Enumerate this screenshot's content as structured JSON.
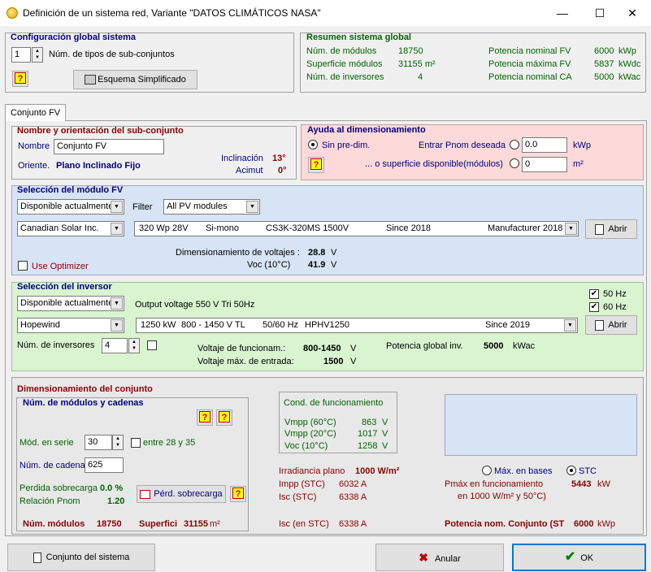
{
  "window": {
    "title": "Definición de un sistema red, Variante   \"DATOS CLIMÁTICOS NASA\"",
    "minimize": "—",
    "maximize": "☐",
    "close": "✕"
  },
  "global_config": {
    "title": "Configuración global sistema",
    "subsets_value": "1",
    "subsets_label": "Núm. de tipos de sub-conjuntos",
    "help": "?",
    "schema_button": "Esquema Simplificado"
  },
  "summary": {
    "title": "Resumen sistema global",
    "modules_label": "Núm. de módulos",
    "modules_value": "18750",
    "surface_label": "Superficie módulos",
    "surface_value": "31155 m²",
    "inverters_label": "Núm. de inversores",
    "inverters_value": "4",
    "pv_nominal_label": "Potencia nominal FV",
    "pv_nominal_value": "6000",
    "pv_nominal_unit": "kWp",
    "pv_max_label": "Potencia máxima FV",
    "pv_max_value": "5837",
    "pv_max_unit": "kWdc",
    "ac_nominal_label": "Potencia nominal CA",
    "ac_nominal_value": "5000",
    "ac_nominal_unit": "kWac"
  },
  "tabs": {
    "tab1": "Conjunto FV"
  },
  "subset": {
    "title": "Nombre y orientación del sub-conjunto",
    "name_label": "Nombre",
    "name_value": "Conjunto FV",
    "orient_label": "Oriente.",
    "orient_value": "Plano Inclinado Fijo",
    "tilt_label": "Inclinación",
    "tilt_value": "13°",
    "azimuth_label": "Acimut",
    "azimuth_value": "0°"
  },
  "sizing_help": {
    "title": "Ayuda al dimensionamiento",
    "no_presize": "Sin pre-dim.",
    "enter_pnom": "Entrar Pnom deseada",
    "pnom_value": "0.0",
    "pnom_unit": "kWp",
    "surface_text": "... o superficie disponible(módulos)",
    "surface_value": "0",
    "surface_unit": "m²",
    "help": "?"
  },
  "module": {
    "title": "Selección del módulo FV",
    "availability": "Disponible actualmente",
    "filter_label": "Filter",
    "filter_value": "All PV modules",
    "manufacturer": "Canadian Solar Inc.",
    "spec_power": "320 Wp 28V",
    "spec_tech": "Si-mono",
    "spec_model": "CS3K-320MS 1500V",
    "spec_since": "Since 2018",
    "spec_source": "Manufacturer 2018",
    "open_button": "Abrir",
    "voltage_sizing_label": "Dimensionamiento de voltajes :",
    "voltage_sizing_value": "28.8",
    "voltage_sizing_unit": "V",
    "voc_label": "Voc  (10°C)",
    "voc_value": "41.9",
    "voc_unit": "V",
    "use_optimizer": "Use Optimizer"
  },
  "inverter": {
    "title": "Selección del inversor",
    "availability": "Disponible actualmente",
    "output_text": "Output voltage 550 V Tri 50Hz",
    "hz50": "50 Hz",
    "hz60": "60 Hz",
    "manufacturer": "Hopewind",
    "spec_power": "1250 kW",
    "spec_voltage": "800 - 1450 V  TL",
    "spec_freq": "50/60 Hz",
    "spec_model": "HPHV1250",
    "spec_since": "Since 2019",
    "open_button": "Abrir",
    "count_label": "Núm. de inversores",
    "count_value": "4",
    "op_voltage_label": "Voltaje de funcionam.:",
    "op_voltage_value": "800-1450",
    "op_voltage_unit": "V",
    "max_voltage_label": "Voltaje máx. de entrada:",
    "max_voltage_value": "1500",
    "max_voltage_unit": "V",
    "global_power_label": "Potencia global inv.",
    "global_power_value": "5000",
    "global_power_unit": "kWac"
  },
  "array": {
    "title": "Dimensionamiento del conjunto",
    "strings_title": "Núm. de módulos y cadenas",
    "help1": "?",
    "help2": "?",
    "series_label": "Mód. en serie",
    "series_value": "30",
    "between_label": "entre 28 y 35",
    "strings_label": "Núm. de cadena",
    "strings_value": "625",
    "overload_label": "Perdida sobrecarga",
    "overload_value": "0.0 %",
    "ratio_label": "Relación Pnom",
    "ratio_value": "1.20",
    "overload_button": "Pérd. sobrecarga",
    "help3": "?",
    "modules_label": "Núm. módulos",
    "modules_value": "18750",
    "surface_label": "Superfici",
    "surface_value": "31155",
    "surface_unit": "m²"
  },
  "operating": {
    "title": "Cond. de funcionamiento",
    "vmpp60_label": "Vmpp (60°C)",
    "vmpp60_value": "863",
    "vmpp20_label": "Vmpp (20°C)",
    "vmpp20_value": "1017",
    "voc10_label": "Voc  (10°C)",
    "voc10_value": "1258",
    "volt_unit": "V",
    "irradiance_label": "Irradiancia plano",
    "irradiance_value": "1000 W/m²",
    "impp_label": "Impp (STC)",
    "impp_value": "6032 A",
    "isc_label": "Isc  (STC)",
    "isc_value": "6338 A",
    "isc_stc_label": "Isc (en STC)",
    "isc_stc_value": "6338 A"
  },
  "power": {
    "max_bases": "Máx. en bases",
    "stc": "STC",
    "pmax_label_1": "Pmáx en funcionamiento",
    "pmax_label_2": "en 1000 W/m²  y 50°C)",
    "pmax_value": "5443",
    "pmax_unit": "kW",
    "nominal_label": "Potencia nom. Conjunto (ST",
    "nominal_value": "6000",
    "nominal_unit": "kWp"
  },
  "footer": {
    "system_button": "Conjunto del sistema",
    "cancel_button": "Anular",
    "ok_button": "OK"
  }
}
